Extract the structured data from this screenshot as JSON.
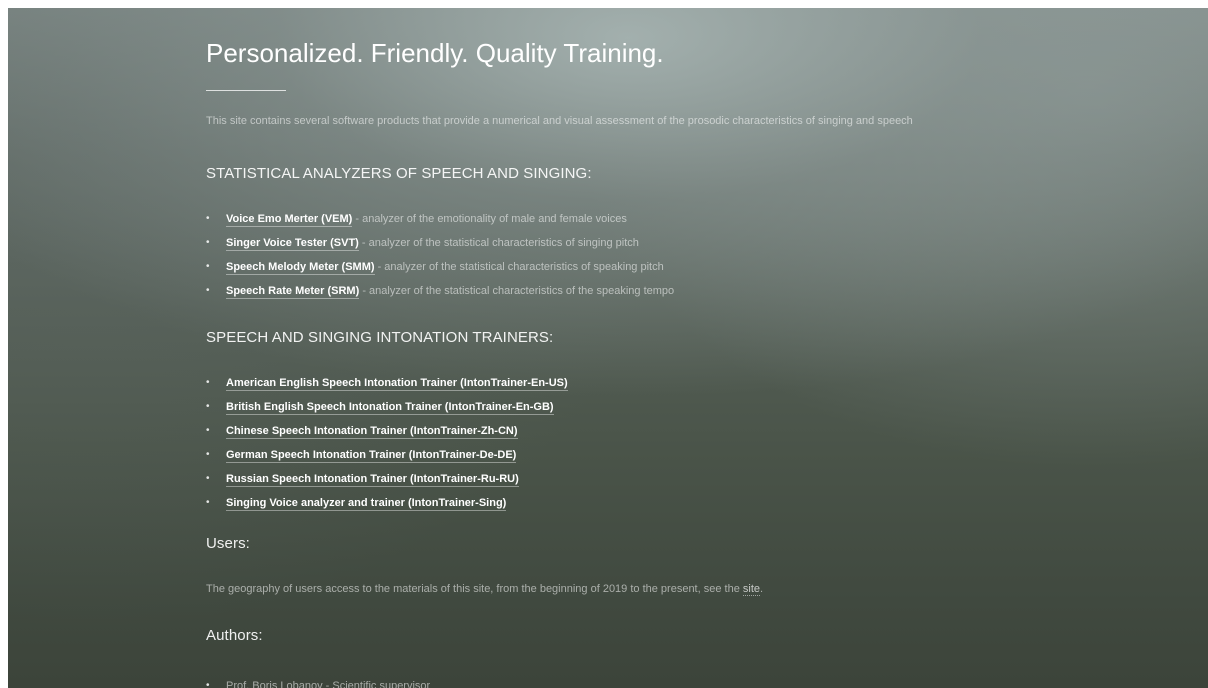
{
  "hero": {
    "title": "Personalized. Friendly. Quality Training.",
    "intro": "This site contains several software products that provide a numerical and visual assessment of the prosodic characteristics of singing and speech"
  },
  "statistical": {
    "heading": "STATISTICAL ANALYZERS OF SPEECH AND SINGING:",
    "items": [
      {
        "link": "Voice Emo Merter (VEM)",
        "desc": " - analyzer of the emotionality of male and female voices"
      },
      {
        "link": "Singer Voice Tester (SVT)",
        "desc": " - analyzer of the statistical characteristics of singing pitch"
      },
      {
        "link": "Speech Melody Meter (SMM)",
        "desc": " - analyzer of the statistical characteristics of speaking pitch"
      },
      {
        "link": "Speech Rate Meter (SRM)",
        "desc": " - analyzer of the statistical characteristics of the speaking tempo"
      }
    ]
  },
  "trainers": {
    "heading": "SPEECH AND SINGING INTONATION TRAINERS:",
    "items": [
      {
        "link": "American English Speech Intonation Trainer (IntonTrainer-En-US)"
      },
      {
        "link": "British English Speech Intonation Trainer (IntonTrainer-En-GB)"
      },
      {
        "link": "Chinese Speech Intonation Trainer (IntonTrainer-Zh-CN)"
      },
      {
        "link": "German Speech Intonation Trainer (IntonTrainer-De-DE)"
      },
      {
        "link": "Russian Speech Intonation Trainer (IntonTrainer-Ru-RU)"
      },
      {
        "link": "Singing Voice analyzer and trainer (IntonTrainer-Sing)"
      }
    ]
  },
  "users": {
    "heading": "Users:",
    "text_before": "The geography of users access to the materials of this site, from the beginning of 2019 to the present, see the ",
    "link": "site",
    "text_after": "."
  },
  "authors": {
    "heading": "Authors:",
    "items": [
      {
        "text": "Prof. Boris Lobanov - Scientific supervisor"
      }
    ]
  },
  "bullet": "•"
}
